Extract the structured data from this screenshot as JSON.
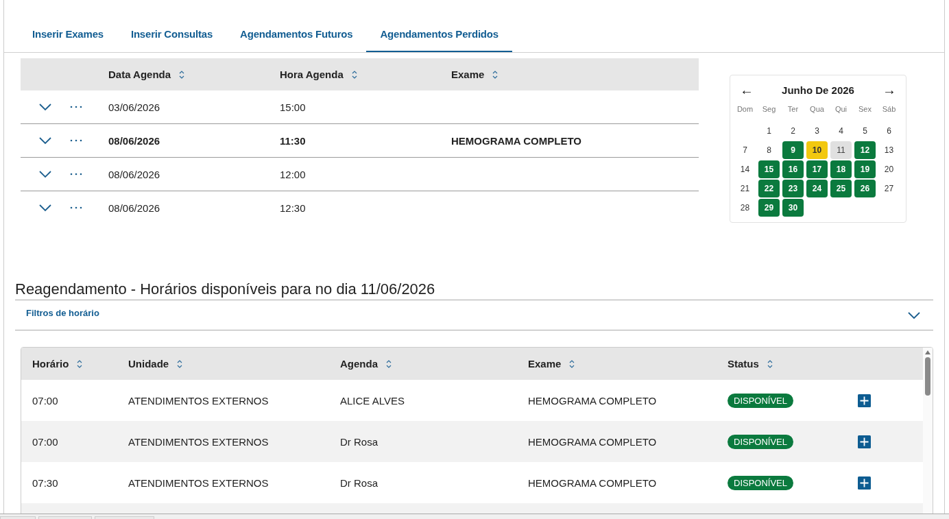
{
  "tabs": [
    {
      "label": "Inserir Exames",
      "selected": false
    },
    {
      "label": "Inserir Consultas",
      "selected": false
    },
    {
      "label": "Agendamentos Futuros",
      "selected": false
    },
    {
      "label": "Agendamentos Perdidos",
      "selected": true
    }
  ],
  "appointments": {
    "columns": [
      "Data Agenda",
      "Hora Agenda",
      "Exame"
    ],
    "rows": [
      {
        "date": "03/06/2026",
        "time": "15:00",
        "exam": null,
        "highlighted": false,
        "expanded": false
      },
      {
        "date": "08/06/2026",
        "time": "11:30",
        "exam": "HEMOGRAMA COMPLETO",
        "highlighted": true,
        "expanded": false
      },
      {
        "date": "08/06/2026",
        "time": "12:00",
        "exam": null,
        "highlighted": false,
        "expanded": false
      },
      {
        "date": "08/06/2026",
        "time": "12:30",
        "exam": null,
        "highlighted": false,
        "expanded": false
      }
    ]
  },
  "calendar": {
    "prev": "←",
    "title": "Junho De 2026",
    "next": "→",
    "weekdays": [
      "Dom",
      "Seg",
      "Ter",
      "Qua",
      "Qui",
      "Sex",
      "Sáb"
    ],
    "days": [
      {
        "kind": "blank"
      },
      {
        "day": "1",
        "available": false,
        "selected": false,
        "disabled": false
      },
      {
        "day": "2",
        "available": false,
        "selected": false,
        "disabled": false
      },
      {
        "day": "3",
        "available": false,
        "selected": false,
        "disabled": false
      },
      {
        "day": "4",
        "available": false,
        "selected": false,
        "disabled": false
      },
      {
        "day": "5",
        "available": false,
        "selected": false,
        "disabled": false
      },
      {
        "day": "6",
        "available": false,
        "selected": false,
        "disabled": false
      },
      {
        "day": "7",
        "available": false,
        "selected": false,
        "disabled": false
      },
      {
        "day": "8",
        "available": false,
        "selected": false,
        "disabled": false
      },
      {
        "day": "9",
        "available": true,
        "selected": false,
        "disabled": false
      },
      {
        "day": "10",
        "available": false,
        "selected": true,
        "disabled": false
      },
      {
        "day": "11",
        "available": false,
        "selected": false,
        "disabled": true
      },
      {
        "day": "12",
        "available": true,
        "selected": false,
        "disabled": false
      },
      {
        "day": "13",
        "available": false,
        "selected": false,
        "disabled": false
      },
      {
        "day": "14",
        "available": false,
        "selected": false,
        "disabled": false
      },
      {
        "day": "15",
        "available": true,
        "selected": false,
        "disabled": false
      },
      {
        "day": "16",
        "available": true,
        "selected": false,
        "disabled": false
      },
      {
        "day": "17",
        "available": true,
        "selected": false,
        "disabled": false
      },
      {
        "day": "18",
        "available": true,
        "selected": false,
        "disabled": false
      },
      {
        "day": "19",
        "available": true,
        "selected": false,
        "disabled": false
      },
      {
        "day": "20",
        "available": false,
        "selected": false,
        "disabled": false
      },
      {
        "day": "21",
        "available": false,
        "selected": false,
        "disabled": false
      },
      {
        "day": "22",
        "available": true,
        "selected": false,
        "disabled": false
      },
      {
        "day": "23",
        "available": true,
        "selected": false,
        "disabled": false
      },
      {
        "day": "24",
        "available": true,
        "selected": false,
        "disabled": false
      },
      {
        "day": "25",
        "available": true,
        "selected": false,
        "disabled": false
      },
      {
        "day": "26",
        "available": true,
        "selected": false,
        "disabled": false
      },
      {
        "day": "27",
        "available": false,
        "selected": false,
        "disabled": false
      },
      {
        "day": "28",
        "available": false,
        "selected": false,
        "disabled": false
      },
      {
        "day": "29",
        "available": true,
        "selected": false,
        "disabled": false
      },
      {
        "day": "30",
        "available": true,
        "selected": false,
        "disabled": false
      }
    ]
  },
  "rescheduling": {
    "title": "Reagendamento - Horários disponíveis para no dia 11/06/2026",
    "filters": {
      "label": "Filtros de horário",
      "expanded": false
    },
    "columns": [
      "Horário",
      "Unidade",
      "Agenda",
      "Exame",
      "Status"
    ],
    "rows": [
      {
        "time": "07:00",
        "unit": "ATENDIMENTOS EXTERNOS",
        "agenda": "ALICE ALVES",
        "exam": "HEMOGRAMA COMPLETO",
        "status": "DISPONÍVEL"
      },
      {
        "time": "07:00",
        "unit": "ATENDIMENTOS EXTERNOS",
        "agenda": "Dr Rosa",
        "exam": "HEMOGRAMA COMPLETO",
        "status": "DISPONÍVEL"
      },
      {
        "time": "07:30",
        "unit": "ATENDIMENTOS EXTERNOS",
        "agenda": "Dr Rosa",
        "exam": "HEMOGRAMA COMPLETO",
        "status": "DISPONÍVEL"
      }
    ]
  }
}
